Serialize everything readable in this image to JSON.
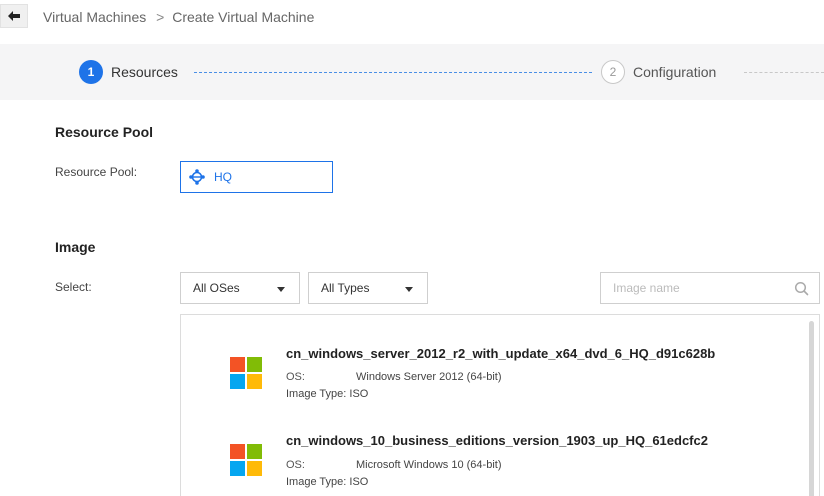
{
  "breadcrumb": {
    "parent": "Virtual Machines",
    "separator": ">",
    "current": "Create Virtual Machine"
  },
  "steps": [
    {
      "number": "1",
      "label": "Resources",
      "state": "active"
    },
    {
      "number": "2",
      "label": "Configuration",
      "state": "pending"
    }
  ],
  "resource_pool": {
    "section_title": "Resource Pool",
    "label": "Resource Pool:",
    "value": "HQ"
  },
  "image": {
    "section_title": "Image",
    "select_label": "Select:",
    "os_filter": "All OSes",
    "type_filter": "All Types",
    "search_placeholder": "Image name",
    "items": [
      {
        "name": "cn_windows_server_2012_r2_with_update_x64_dvd_6_HQ_d91c628b",
        "os_label": "OS:",
        "os": "Windows Server 2012 (64-bit)",
        "type_label": "Image Type:",
        "type": "ISO"
      },
      {
        "name": "cn_windows_10_business_editions_version_1903_up_HQ_61edcfc2",
        "os_label": "OS:",
        "os": "Microsoft Windows 10 (64-bit)",
        "type_label": "Image Type:",
        "type": "ISO"
      }
    ]
  },
  "colors": {
    "accent": "#1e73e8",
    "win_red": "#f35325",
    "win_green": "#81bc06",
    "win_blue": "#05a6f0",
    "win_yellow": "#ffba08"
  }
}
